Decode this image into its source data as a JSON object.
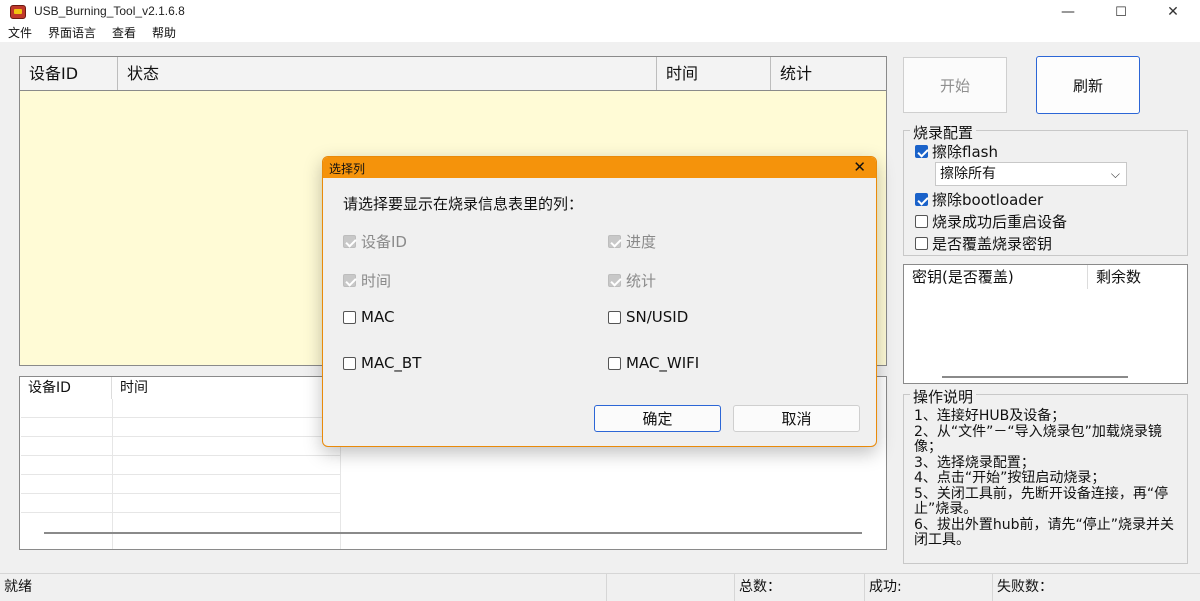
{
  "window": {
    "title": "USB_Burning_Tool_v2.1.6.8",
    "minimize": "—",
    "maximize": "☐",
    "close": "✕"
  },
  "menu": [
    "文件",
    "界面语言",
    "查看",
    "帮助"
  ],
  "main_table": {
    "columns": [
      "设备ID",
      "状态",
      "时间",
      "统计"
    ]
  },
  "log_table": {
    "columns": [
      "设备ID",
      "时间"
    ]
  },
  "buttons": {
    "start": "开始",
    "refresh": "刷新"
  },
  "burn_config": {
    "title": "烧录配置",
    "erase_flash": {
      "label": "擦除flash",
      "checked": true
    },
    "erase_select": "擦除所有",
    "erase_bootloader": {
      "label": "擦除bootloader",
      "checked": true
    },
    "reboot_after": {
      "label": "烧录成功后重启设备",
      "checked": false
    },
    "overwrite_key": {
      "label": "是否覆盖烧录密钥",
      "checked": false
    }
  },
  "key_table": {
    "columns": [
      "密钥(是否覆盖)",
      "剩余数"
    ]
  },
  "ops": {
    "title": "操作说明",
    "text": "1、连接好HUB及设备；\n2、从“文件”－“导入烧录包”加载烧录镜像；\n3、选择烧录配置；\n4、点击“开始”按钮启动烧录；\n5、关闭工具前，先断开设备连接，再“停止”烧录。\n6、拔出外置hub前，请先“停止”烧录并关闭工具。"
  },
  "status": {
    "ready": "就绪",
    "total": "总数：",
    "success": "成功:",
    "fail": "失败数："
  },
  "dialog": {
    "title": "选择列",
    "prompt": "请选择要显示在烧录信息表里的列：",
    "options": [
      {
        "label": "设备ID",
        "state": "disabled-checked"
      },
      {
        "label": "进度",
        "state": "disabled-checked"
      },
      {
        "label": "时间",
        "state": "disabled-checked"
      },
      {
        "label": "统计",
        "state": "disabled-checked"
      },
      {
        "label": "MAC",
        "state": "unchecked"
      },
      {
        "label": "SN/USID",
        "state": "unchecked"
      },
      {
        "label": "MAC_BT",
        "state": "unchecked"
      },
      {
        "label": "MAC_WIFI",
        "state": "unchecked"
      }
    ],
    "ok": "确定",
    "cancel": "取消"
  },
  "colors": {
    "dialog_title_bar": "#f5930b",
    "main_table_bg": "#fffbd6",
    "accent_blue": "#2c66d6",
    "checkbox_blue": "#1a62c9"
  }
}
